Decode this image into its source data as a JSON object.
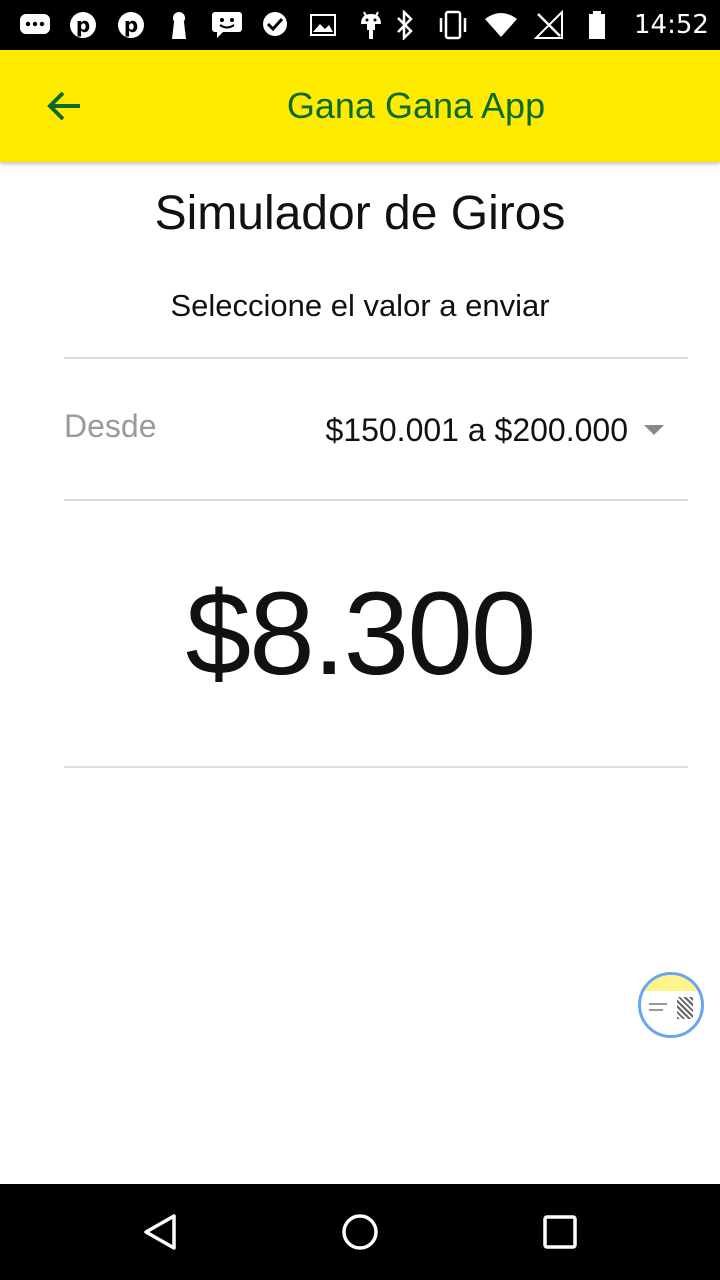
{
  "status_bar": {
    "time": "14:52",
    "left_icons": [
      "messages-icon",
      "pinterest-icon",
      "pinterest-icon",
      "keyhole-icon",
      "chat-icon",
      "heart-chat-icon",
      "image-icon",
      "android-icon"
    ],
    "right_icons": [
      "bluetooth-icon",
      "vibrate-icon",
      "wifi-icon",
      "no-signal-icon",
      "battery-icon"
    ]
  },
  "app_bar": {
    "title": "Gana Gana App",
    "background": "#ffeb00",
    "title_color": "#0a6b2a"
  },
  "main": {
    "title": "Simulador de Giros",
    "subtitle": "Seleccione el valor a enviar",
    "range_label": "Desde",
    "range_selected": "$150.001 a $200.000",
    "amount": "$8.300"
  },
  "nav_bar": {
    "buttons": [
      "back-icon",
      "home-icon",
      "recents-icon"
    ]
  }
}
